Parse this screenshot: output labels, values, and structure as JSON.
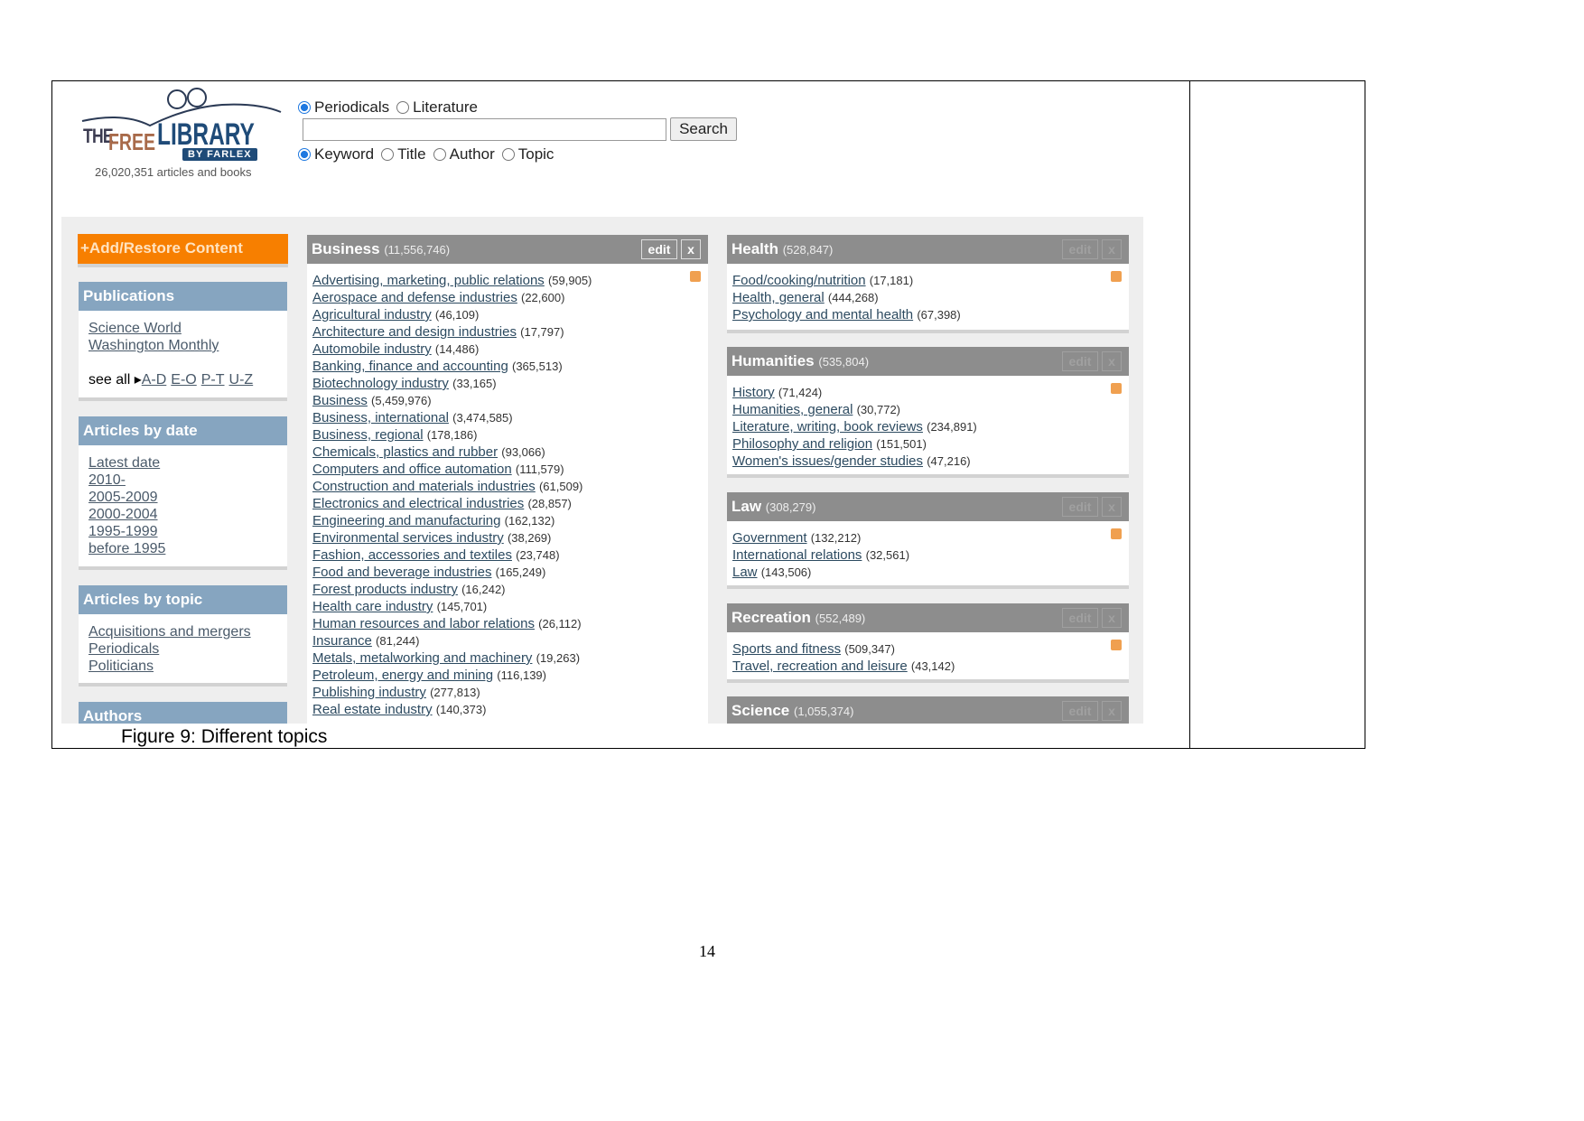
{
  "logo": {
    "the": "THE",
    "free": "FREE",
    "library": "LIBRARY",
    "by": "BY FARLEX",
    "count": "26,020,351 articles and books"
  },
  "search": {
    "scope": [
      {
        "label": "Periodicals",
        "checked": true
      },
      {
        "label": "Literature",
        "checked": false
      }
    ],
    "value": "",
    "button": "Search",
    "fields": [
      {
        "label": "Keyword",
        "checked": true
      },
      {
        "label": "Title",
        "checked": false
      },
      {
        "label": "Author",
        "checked": false
      },
      {
        "label": "Topic",
        "checked": false
      }
    ]
  },
  "sidebar": {
    "add_button": "+Add/Restore Content",
    "publications": {
      "title": "Publications",
      "items": [
        "Science World",
        "Washington Monthly"
      ],
      "see_all": "see all",
      "ranges": [
        "A-D",
        "E-O",
        "P-T",
        "U-Z"
      ]
    },
    "by_date": {
      "title": "Articles by date",
      "items": [
        "Latest date",
        "2010-",
        "2005-2009",
        "2000-2004",
        "1995-1999",
        "before 1995"
      ]
    },
    "by_topic": {
      "title": "Articles by topic",
      "items": [
        "Acquisitions and mergers",
        "Periodicals",
        "Politicians"
      ]
    },
    "authors": {
      "title": "Authors"
    }
  },
  "controls": {
    "edit": "edit",
    "close": "x"
  },
  "business": {
    "title": "Business",
    "count": "(11,556,746)",
    "items": [
      [
        "Advertising, marketing, public relations",
        "(59,905)"
      ],
      [
        "Aerospace and defense industries",
        "(22,600)"
      ],
      [
        "Agricultural industry",
        "(46,109)"
      ],
      [
        "Architecture and design industries",
        "(17,797)"
      ],
      [
        "Automobile industry",
        "(14,486)"
      ],
      [
        "Banking, finance and accounting",
        "(365,513)"
      ],
      [
        "Biotechnology industry",
        "(33,165)"
      ],
      [
        "Business",
        "(5,459,976)"
      ],
      [
        "Business, international",
        "(3,474,585)"
      ],
      [
        "Business, regional",
        "(178,186)"
      ],
      [
        "Chemicals, plastics and rubber",
        "(93,066)"
      ],
      [
        "Computers and office automation",
        "(111,579)"
      ],
      [
        "Construction and materials industries",
        "(61,509)"
      ],
      [
        "Electronics and electrical industries",
        "(28,857)"
      ],
      [
        "Engineering and manufacturing",
        "(162,132)"
      ],
      [
        "Environmental services industry",
        "(38,269)"
      ],
      [
        "Fashion, accessories and textiles",
        "(23,748)"
      ],
      [
        "Food and beverage industries",
        "(165,249)"
      ],
      [
        "Forest products industry",
        "(16,242)"
      ],
      [
        "Health care industry",
        "(145,701)"
      ],
      [
        "Human resources and labor relations",
        "(26,112)"
      ],
      [
        "Insurance",
        "(81,244)"
      ],
      [
        "Metals, metalworking and machinery",
        "(19,263)"
      ],
      [
        "Petroleum, energy and mining",
        "(116,139)"
      ],
      [
        "Publishing industry",
        "(277,813)"
      ],
      [
        "Real estate industry",
        "(140,373)"
      ]
    ]
  },
  "right": [
    {
      "title": "Health",
      "count": "(528,847)",
      "items": [
        [
          "Food/cooking/nutrition",
          "(17,181)"
        ],
        [
          "Health, general",
          "(444,268)"
        ],
        [
          "Psychology and mental health",
          "(67,398)"
        ]
      ]
    },
    {
      "title": "Humanities",
      "count": "(535,804)",
      "items": [
        [
          "History",
          "(71,424)"
        ],
        [
          "Humanities, general",
          "(30,772)"
        ],
        [
          "Literature, writing, book reviews",
          "(234,891)"
        ],
        [
          "Philosophy and religion",
          "(151,501)"
        ],
        [
          "Women's issues/gender studies",
          "(47,216)"
        ]
      ]
    },
    {
      "title": "Law",
      "count": "(308,279)",
      "items": [
        [
          "Government",
          "(132,212)"
        ],
        [
          "International relations",
          "(32,561)"
        ],
        [
          "Law",
          "(143,506)"
        ]
      ]
    },
    {
      "title": "Recreation",
      "count": "(552,489)",
      "items": [
        [
          "Sports and fitness",
          "(509,347)"
        ],
        [
          "Travel, recreation and leisure",
          "(43,142)"
        ]
      ]
    },
    {
      "title": "Science",
      "count": "(1,055,374)",
      "items": []
    }
  ],
  "colors": {
    "orange": "#f77f00",
    "blue_header": "#86a5c0",
    "grey_header": "#8d8d8d",
    "link": "#2c4a60"
  },
  "caption": "Figure 9: Different topics",
  "page_number": "14"
}
